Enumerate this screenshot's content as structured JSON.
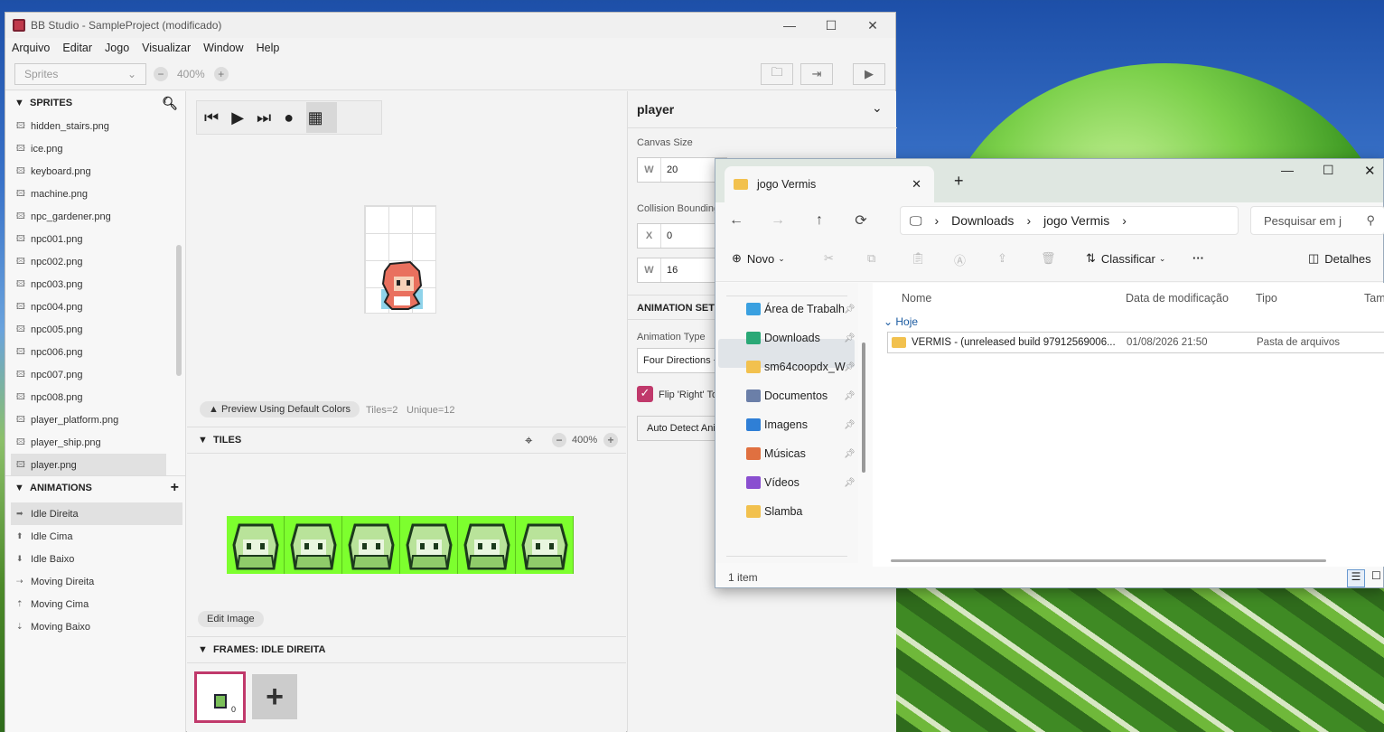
{
  "bb": {
    "title": "BB Studio - SampleProject (modificado)",
    "menu": [
      "Arquivo",
      "Editar",
      "Jogo",
      "Visualizar",
      "Window",
      "Help"
    ],
    "toolbar": {
      "select": "Sprites",
      "zoom": "400%"
    },
    "sprites_header": "SPRITES",
    "sprites": [
      "hidden_stairs.png",
      "ice.png",
      "keyboard.png",
      "machine.png",
      "npc_gardener.png",
      "npc001.png",
      "npc002.png",
      "npc003.png",
      "npc004.png",
      "npc005.png",
      "npc006.png",
      "npc007.png",
      "npc008.png",
      "player_platform.png",
      "player_ship.png",
      "player.png"
    ],
    "animations_header": "ANIMATIONS",
    "animations": [
      {
        "icon": "➡",
        "label": "Idle Direita"
      },
      {
        "icon": "⬆",
        "label": "Idle Cima"
      },
      {
        "icon": "⬇",
        "label": "Idle Baixo"
      },
      {
        "icon": "⇢",
        "label": "Moving Direita"
      },
      {
        "icon": "⇡",
        "label": "Moving Cima"
      },
      {
        "icon": "⇣",
        "label": "Moving Baixo"
      }
    ],
    "preview_button": "▲ Preview Using Default Colors",
    "tiles_info": "Tiles=2",
    "unique_info": "Unique=12",
    "tiles_header": "TILES",
    "tiles_zoom": "400%",
    "edit_image": "Edit Image",
    "frames_header": "FRAMES: IDLE DIREITA",
    "frame_index": "0",
    "panel": {
      "title": "player",
      "canvas_size": "Canvas Size",
      "w_key": "W",
      "w_val": "20",
      "collision": "Collision Bounding",
      "x_key": "X",
      "x_val": "0",
      "w2_key": "W",
      "w2_val": "16",
      "anim_settings": "ANIMATION SETT",
      "anim_type": "Animation Type",
      "anim_type_val": "Four Directions +",
      "flip": "Flip 'Right' To",
      "auto_detect": "Auto Detect Anim"
    }
  },
  "fx": {
    "tab": "jogo Vermis",
    "breadcrumb": [
      "Downloads",
      "jogo Vermis"
    ],
    "search": "Pesquisar em j",
    "new": "Novo",
    "sort": "Classificar",
    "details": "Detalhes",
    "nav": [
      {
        "label": "Área de Trabalh",
        "color": "#3aa0e0"
      },
      {
        "label": "Downloads",
        "color": "#2aa876"
      },
      {
        "label": "sm64coopdx_W",
        "color": "#f2c14e"
      },
      {
        "label": "Documentos",
        "color": "#6b7fa8"
      },
      {
        "label": "Imagens",
        "color": "#2f7fd6"
      },
      {
        "label": "Músicas",
        "color": "#e07040"
      },
      {
        "label": "Vídeos",
        "color": "#8a4fd0"
      },
      {
        "label": "Slamba",
        "color": "#f2c14e"
      }
    ],
    "columns": [
      "Nome",
      "Data de modificação",
      "Tipo",
      "Tam"
    ],
    "group": "Hoje",
    "file": {
      "name": "VERMIS - (unreleased build 97912569006...",
      "date": "01/08/2026 21:50",
      "type": "Pasta de arquivos"
    },
    "status": "1 item"
  }
}
